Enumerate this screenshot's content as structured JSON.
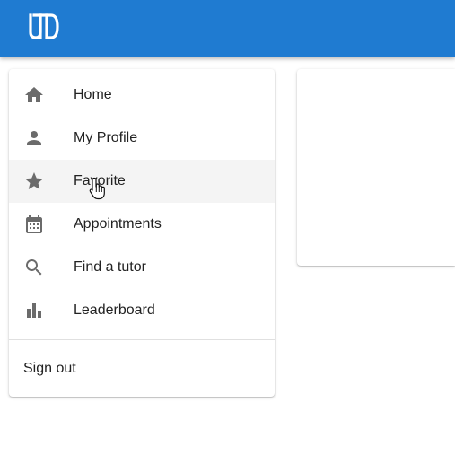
{
  "app": {
    "logo_text": "UTD",
    "brand_color": "#1f7bd1"
  },
  "nav": {
    "items": [
      {
        "label": "Home",
        "icon": "home-icon"
      },
      {
        "label": "My Profile",
        "icon": "person-icon"
      },
      {
        "label": "Favorite",
        "icon": "star-icon",
        "hovered": true
      },
      {
        "label": "Appointments",
        "icon": "calendar-icon"
      },
      {
        "label": "Find a tutor",
        "icon": "search-icon"
      },
      {
        "label": "Leaderboard",
        "icon": "bar-chart-icon"
      }
    ],
    "sign_out_label": "Sign out"
  }
}
